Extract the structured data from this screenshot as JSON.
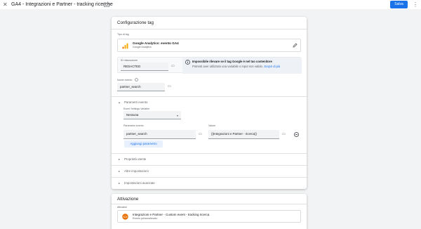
{
  "topbar": {
    "close_glyph": "✕",
    "title": "GA4 - Integrazioni e Partner - tracking ricerche",
    "save_label": "Salva",
    "more_glyph": "⋮"
  },
  "config": {
    "heading": "Configurazione tag",
    "tag_type_label": "Tipo di tag",
    "tag_type_name": "Google Analytics: evento GA4",
    "tag_type_sub": "Google Analytics",
    "measurement_id_label": "ID misurazione",
    "measurement_id_value": "REDACTED",
    "info_title": "Impossibile rilevare se il tag Google è nel tuo contenitore",
    "info_body": "Potresti aver utilizzato una variabile o input non valido.",
    "info_link": "Scopri di più",
    "event_name_label": "Nome evento",
    "event_name_value": "partner_search",
    "event_params_title": "Parametri evento",
    "event_settings_label": "Event Settings Variable",
    "event_settings_value": "Nessuna",
    "param_label": "Parametro evento",
    "value_label": "Valore",
    "param_row": {
      "param": "partner_search",
      "value": "{{Integrazioni e Partner - ricerca}}"
    },
    "add_param_label": "Aggiungi parametro",
    "user_props_title": "Proprietà utente",
    "other_settings_title": "Altre impostazioni",
    "advanced_title": "Impostazioni avanzate"
  },
  "activation": {
    "heading": "Attivazione",
    "triggers_label": "Attivatori",
    "trigger_name": "Integrazioni e Partner - Custom event - tracking ricerca",
    "trigger_sub": "Evento personalizzato"
  },
  "colors": {
    "accent": "#1a73e8",
    "analytics_orange": "#f9ab00",
    "trigger_orange": "#e8710a"
  }
}
